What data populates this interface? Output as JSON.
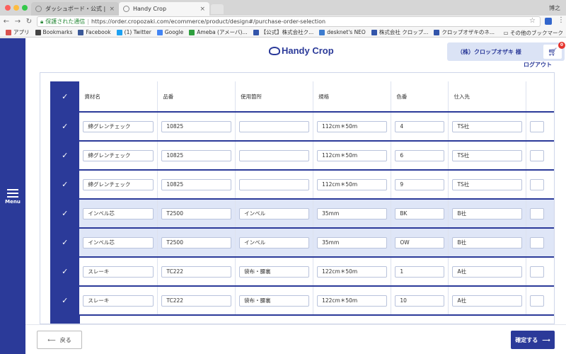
{
  "browser": {
    "tabs": [
      {
        "title": "ダッシュボード・公式 | 株式会社",
        "active": false
      },
      {
        "title": "Handy Crop",
        "active": true
      }
    ],
    "user": "博之",
    "secure_label": "保護された通信",
    "url": "https://order.cropozaki.com/ecommerce/product/design#/purchase-order-selection",
    "bookmarks": [
      {
        "label": "アプリ",
        "icon": "apps-grid-icon",
        "color": "#d9534f"
      },
      {
        "label": "Bookmarks",
        "icon": "star-icon",
        "color": "#444444"
      },
      {
        "label": "Facebook",
        "icon": "facebook-icon",
        "color": "#3b5998"
      },
      {
        "label": "(1) Twitter",
        "icon": "twitter-icon",
        "color": "#1da1f2"
      },
      {
        "label": "Google",
        "icon": "google-icon",
        "color": "#4285f4"
      },
      {
        "label": "Ameba (アメーバ)...",
        "icon": "ameba-icon",
        "color": "#2e9f3e"
      },
      {
        "label": "【公式】株式会社ク...",
        "icon": "site-icon",
        "color": "#3355aa"
      },
      {
        "label": "desknet's NEO",
        "icon": "desknets-icon",
        "color": "#3d7ccf"
      },
      {
        "label": "株式会社 クロップ...",
        "icon": "site-icon",
        "color": "#3355aa"
      },
      {
        "label": "クロップオザキのネ...",
        "icon": "site-icon",
        "color": "#3355aa"
      }
    ],
    "bookmarks_more": "その他のブックマーク"
  },
  "app": {
    "brand": "Handy Crop",
    "menu_label": "Menu",
    "company": "（株）クロップオザキ 様",
    "cart_count": "0",
    "logout": "ログアウト",
    "accent": "#2b3a99",
    "back_button": "戻る",
    "confirm_button": "確定する"
  },
  "table": {
    "columns": [
      "資材名",
      "品番",
      "使用箇所",
      "規格",
      "色番",
      "仕入先"
    ],
    "rows": [
      {
        "name": "綿グレンチェック",
        "code": "10825",
        "usage": "",
        "spec": "112cm＊50m",
        "color": "4",
        "supplier": "TS社",
        "shaded": false
      },
      {
        "name": "綿グレンチェック",
        "code": "10825",
        "usage": "",
        "spec": "112cm＊50m",
        "color": "6",
        "supplier": "TS社",
        "shaded": false
      },
      {
        "name": "綿グレンチェック",
        "code": "10825",
        "usage": "",
        "spec": "112cm＊50m",
        "color": "9",
        "supplier": "TS社",
        "shaded": false
      },
      {
        "name": "インベル芯",
        "code": "T2500",
        "usage": "インベル",
        "spec": "35mm",
        "color": "BK",
        "supplier": "B社",
        "shaded": true
      },
      {
        "name": "インベル芯",
        "code": "T2500",
        "usage": "インベル",
        "spec": "35mm",
        "color": "OW",
        "supplier": "B社",
        "shaded": true
      },
      {
        "name": "スレーキ",
        "code": "TC222",
        "usage": "袋布・腰裏",
        "spec": "122cm＊50m",
        "color": "1",
        "supplier": "A社",
        "shaded": false
      },
      {
        "name": "スレーキ",
        "code": "TC222",
        "usage": "袋布・腰裏",
        "spec": "122cm＊50m",
        "color": "10",
        "supplier": "A社",
        "shaded": false
      }
    ]
  }
}
